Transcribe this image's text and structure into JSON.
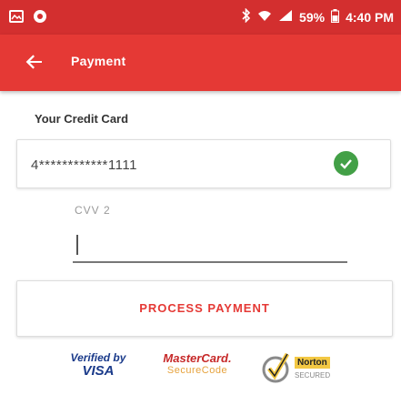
{
  "status_bar": {
    "time": "4:40 PM",
    "battery_percent": "59%"
  },
  "toolbar": {
    "title": "Payment"
  },
  "form": {
    "section_title": "Your Credit Card",
    "card_number": "4************1111",
    "cvv_label": "CVV 2",
    "cvv_value": ""
  },
  "actions": {
    "process_label": "PROCESS PAYMENT"
  },
  "badges": {
    "visa_line1": "Verified by",
    "visa_line2": "VISA",
    "mastercard_line1": "MasterCard.",
    "mastercard_line2": "SecureCode",
    "norton_label": "Norton",
    "norton_sub": "SECURED"
  },
  "colors": {
    "primary": "#e53935",
    "status_bar": "#d32f2f",
    "check": "#43a047"
  }
}
